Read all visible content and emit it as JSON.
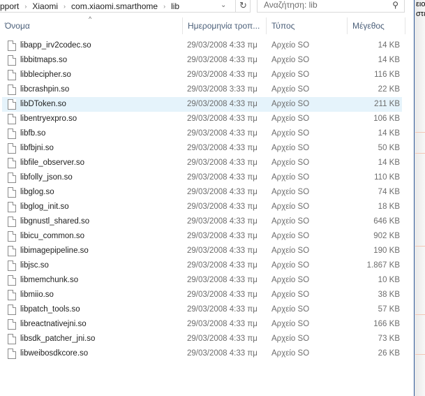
{
  "address": {
    "crumbs": [
      "pport",
      "Xiaomi",
      "com.xiaomi.smarthome",
      "lib"
    ]
  },
  "search": {
    "placeholder": "Αναζήτηση: lib"
  },
  "columns": {
    "name": "Όνομα",
    "date": "Ημερομηνία τροπ...",
    "type": "Τύπος",
    "size": "Μέγεθος"
  },
  "right_text": [
    "ειο",
    "στε"
  ],
  "files": [
    {
      "name": "libapp_irv2codec.so",
      "date": "29/03/2008 4:33 πμ",
      "type": "Αρχείο SO",
      "size": "14 KB"
    },
    {
      "name": "libbitmaps.so",
      "date": "29/03/2008 4:33 πμ",
      "type": "Αρχείο SO",
      "size": "14 KB"
    },
    {
      "name": "libblecipher.so",
      "date": "29/03/2008 4:33 πμ",
      "type": "Αρχείο SO",
      "size": "116 KB"
    },
    {
      "name": "libcrashpin.so",
      "date": "29/03/2008 3:33 πμ",
      "type": "Αρχείο SO",
      "size": "22 KB"
    },
    {
      "name": "libDToken.so",
      "date": "29/03/2008 4:33 πμ",
      "type": "Αρχείο SO",
      "size": "211 KB"
    },
    {
      "name": "libentryexpro.so",
      "date": "29/03/2008 4:33 πμ",
      "type": "Αρχείο SO",
      "size": "106 KB"
    },
    {
      "name": "libfb.so",
      "date": "29/03/2008 4:33 πμ",
      "type": "Αρχείο SO",
      "size": "14 KB"
    },
    {
      "name": "libfbjni.so",
      "date": "29/03/2008 4:33 πμ",
      "type": "Αρχείο SO",
      "size": "50 KB"
    },
    {
      "name": "libfile_observer.so",
      "date": "29/03/2008 4:33 πμ",
      "type": "Αρχείο SO",
      "size": "14 KB"
    },
    {
      "name": "libfolly_json.so",
      "date": "29/03/2008 4:33 πμ",
      "type": "Αρχείο SO",
      "size": "110 KB"
    },
    {
      "name": "libglog.so",
      "date": "29/03/2008 4:33 πμ",
      "type": "Αρχείο SO",
      "size": "74 KB"
    },
    {
      "name": "libglog_init.so",
      "date": "29/03/2008 4:33 πμ",
      "type": "Αρχείο SO",
      "size": "18 KB"
    },
    {
      "name": "libgnustl_shared.so",
      "date": "29/03/2008 4:33 πμ",
      "type": "Αρχείο SO",
      "size": "646 KB"
    },
    {
      "name": "libicu_common.so",
      "date": "29/03/2008 4:33 πμ",
      "type": "Αρχείο SO",
      "size": "902 KB"
    },
    {
      "name": "libimagepipeline.so",
      "date": "29/03/2008 4:33 πμ",
      "type": "Αρχείο SO",
      "size": "190 KB"
    },
    {
      "name": "libjsc.so",
      "date": "29/03/2008 4:33 πμ",
      "type": "Αρχείο SO",
      "size": "1.867 KB"
    },
    {
      "name": "libmemchunk.so",
      "date": "29/03/2008 4:33 πμ",
      "type": "Αρχείο SO",
      "size": "10 KB"
    },
    {
      "name": "libmiio.so",
      "date": "29/03/2008 4:33 πμ",
      "type": "Αρχείο SO",
      "size": "38 KB"
    },
    {
      "name": "libpatch_tools.so",
      "date": "29/03/2008 4:33 πμ",
      "type": "Αρχείο SO",
      "size": "57 KB"
    },
    {
      "name": "libreactnativejni.so",
      "date": "29/03/2008 4:33 πμ",
      "type": "Αρχείο SO",
      "size": "166 KB"
    },
    {
      "name": "libsdk_patcher_jni.so",
      "date": "29/03/2008 4:33 πμ",
      "type": "Αρχείο SO",
      "size": "73 KB"
    },
    {
      "name": "libweibosdkcore.so",
      "date": "29/03/2008 4:33 πμ",
      "type": "Αρχείο SO",
      "size": "26 KB"
    }
  ],
  "selected_index": 4
}
